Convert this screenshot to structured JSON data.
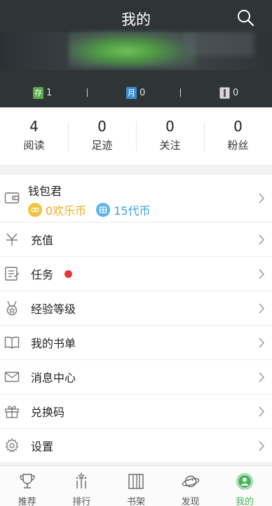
{
  "header": {
    "title": "我的",
    "stats": [
      {
        "icon": "deposit-badge-icon",
        "badge": "存",
        "value": "1"
      },
      {
        "icon": "monthly-ticket-icon",
        "badge": "月",
        "value": "0"
      },
      {
        "icon": "recommend-ticket-icon",
        "badge": "",
        "value": "0"
      }
    ]
  },
  "counts": [
    {
      "value": "4",
      "label": "阅读"
    },
    {
      "value": "0",
      "label": "足迹"
    },
    {
      "value": "0",
      "label": "关注"
    },
    {
      "value": "0",
      "label": "粉丝"
    }
  ],
  "wallet": {
    "title": "钱包君",
    "happy_coin": "0欢乐币",
    "voucher": "15代币"
  },
  "menu": [
    {
      "label": "充值",
      "icon": "yuan-icon"
    },
    {
      "label": "任务",
      "icon": "task-list-icon",
      "dot": true
    },
    {
      "label": "经验等级",
      "icon": "medal-icon"
    },
    {
      "label": "我的书单",
      "icon": "book-list-icon"
    },
    {
      "label": "消息中心",
      "icon": "envelope-icon"
    },
    {
      "label": "兑换码",
      "icon": "gift-icon"
    },
    {
      "label": "设置",
      "icon": "gear-icon"
    }
  ],
  "tabs": [
    {
      "label": "推荐",
      "icon": "trophy-icon"
    },
    {
      "label": "排行",
      "icon": "ranking-icon"
    },
    {
      "label": "书架",
      "icon": "bookshelf-icon"
    },
    {
      "label": "发现",
      "icon": "planet-icon"
    },
    {
      "label": "我的",
      "icon": "user-icon",
      "active": true
    }
  ],
  "colors": {
    "header_bg": "#2f3437",
    "accent_green": "#46b35a",
    "coin_gold": "#f0ad1e",
    "coin_blue": "#3aa3e0",
    "badge_red": "#e8383b"
  }
}
